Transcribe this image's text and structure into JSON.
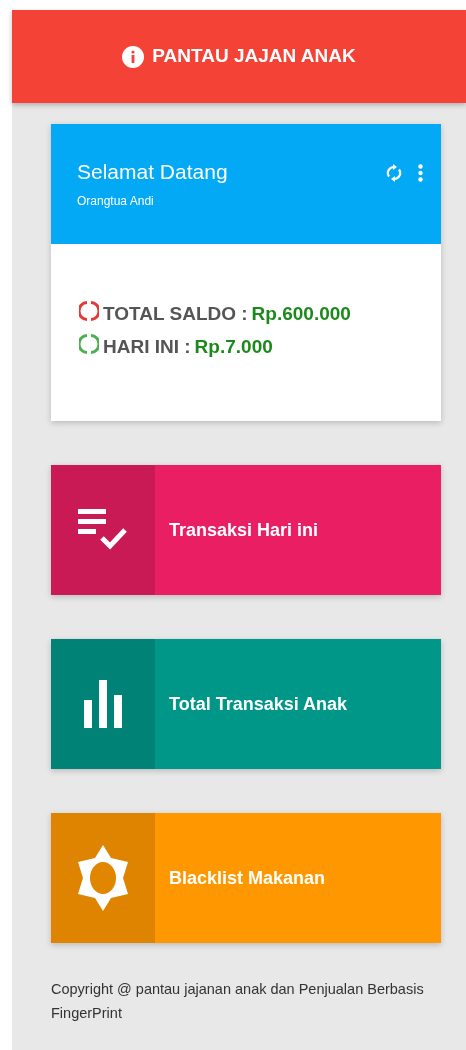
{
  "header": {
    "title": "PANTAU JAJAN ANAK"
  },
  "welcome_card": {
    "title": "Selamat Datang",
    "subtitle": "Orangtua Andi",
    "stats": [
      {
        "label": "TOTAL SALDO :",
        "value": "Rp.600.000",
        "color": "#e53935"
      },
      {
        "label": "HARI INI :",
        "value": "Rp.7.000",
        "color": "#4caf50"
      }
    ]
  },
  "menu_tiles": [
    {
      "label": "Transaksi Hari ini",
      "kind": "checklist",
      "color": "#e91e63"
    },
    {
      "label": "Total Transaksi Anak",
      "kind": "chart",
      "color": "#009688"
    },
    {
      "label": "Blacklist Makanan",
      "kind": "brightness",
      "color": "#ff9800"
    }
  ],
  "footer": {
    "text": "Copyright @ pantau jajanan anak dan Penjualan Berbasis FingerPrint"
  }
}
